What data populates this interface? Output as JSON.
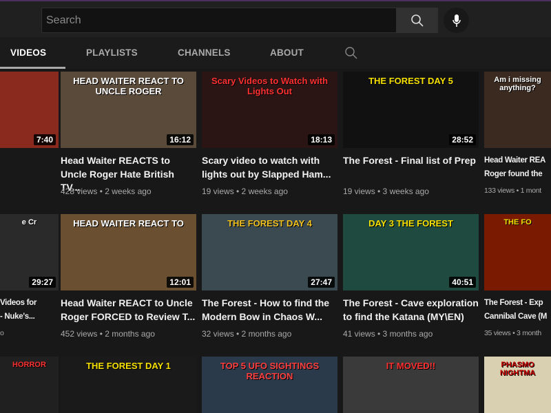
{
  "header": {
    "search_placeholder": "Search"
  },
  "tabs": [
    "VIDEOS",
    "PLAYLISTS",
    "CHANNELS",
    "ABOUT"
  ],
  "colors": {
    "accent": "#4b2f5c",
    "bg": "#181818"
  },
  "videos": [
    {
      "title": "",
      "meta": "",
      "duration": "7:40",
      "caption": "",
      "bg": "#8a2a1e"
    },
    {
      "title": "Head Waiter REACTS to\nUncle Roger Hate British TV...",
      "meta": "428 views • 2 weeks ago",
      "duration": "16:12",
      "caption": "HEAD WAITER REACT TO UNCLE ROGER",
      "bg": "#5a4a3a"
    },
    {
      "title": "Scary video to watch with\nlights out by Slapped Ham...",
      "meta": "19 views • 2 weeks ago",
      "duration": "18:13",
      "caption": "Scary Videos to Watch with Lights Out",
      "bg": "#2a1414",
      "capcolor": "#ff3030"
    },
    {
      "title": "The Forest - Final list of Prep",
      "meta": "19 views • 3 weeks ago",
      "duration": "28:52",
      "caption": "THE FOREST  DAY 5",
      "bg": "#111",
      "capcolor": "#f5e000"
    },
    {
      "title": "Head Waiter REA\nRoger found the",
      "meta": "133 views • 1 mont",
      "duration": "",
      "caption": "Am i missing anything?",
      "bg": "#3a2a20"
    },
    {
      "title": "Videos for\n- Nuke's...",
      "meta": "o",
      "duration": "29:27",
      "caption": "e Cr",
      "bg": "#2a2a2a"
    },
    {
      "title": "Head Waiter REACT to Uncle\nRoger FORCED to Review T...",
      "meta": "452 views • 2 months ago",
      "duration": "12:01",
      "caption": "HEAD WAITER REACT TO",
      "bg": "#6a5030"
    },
    {
      "title": "The Forest - How to find the\nModern Bow in Chaos W...",
      "meta": "32 views • 2 months ago",
      "duration": "27:47",
      "caption": "THE FOREST  DAY 4",
      "bg": "#3a4a50",
      "capcolor": "#f0c020"
    },
    {
      "title": "The Forest - Cave exploration\nto find the Katana (MY\\EN)",
      "meta": "41 views • 3 months ago",
      "duration": "40:51",
      "caption": "DAY 3  THE FOREST",
      "bg": "#1f4a40",
      "capcolor": "#f5e000"
    },
    {
      "title": "The Forest - Exp\nCannibal Cave (M",
      "meta": "35 views • 3 month",
      "duration": "",
      "caption": "THE FO",
      "bg": "#7a1a00",
      "capcolor": "#f5e000"
    },
    {
      "title": "",
      "meta": "",
      "duration": "",
      "caption": "HORROR",
      "bg": "#202020",
      "capcolor": "#ff3030"
    },
    {
      "title": "",
      "meta": "",
      "duration": "",
      "caption": "THE FOREST  DAY 1",
      "bg": "#1a1a1a",
      "capcolor": "#f5e000"
    },
    {
      "title": "",
      "meta": "",
      "duration": "",
      "caption": "TOP 5 UFO SIGHTINGS REACTION",
      "bg": "#2a3a4a",
      "capcolor": "#ff4040"
    },
    {
      "title": "",
      "meta": "",
      "duration": "",
      "caption": "IT MOVED!!",
      "bg": "#3a3a3a",
      "capcolor": "#ff3030"
    },
    {
      "title": "",
      "meta": "",
      "duration": "",
      "caption": "PHASMO NIGHTMA",
      "bg": "#d8d0b0",
      "capcolor": "#c00"
    }
  ]
}
